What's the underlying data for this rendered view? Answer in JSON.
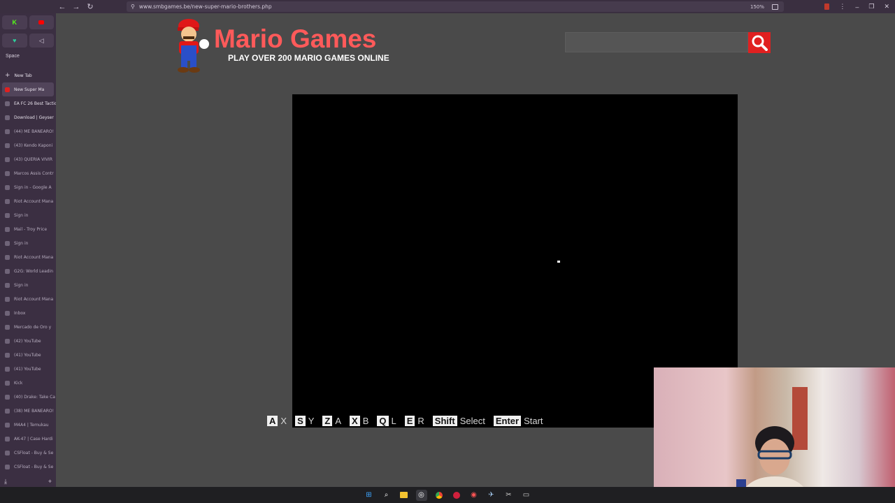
{
  "browser": {
    "url": "www.smbgames.be/new-super-mario-brothers.php",
    "zoom": "150%"
  },
  "sidebar": {
    "space_label": "Space",
    "new_tab_label": "New Tab",
    "tabs": [
      {
        "label": "New Super Ma",
        "active": true
      },
      {
        "label": "EA FC 26 Best Tactic"
      },
      {
        "label": "Download | Geyser"
      },
      {
        "label": "(44) ME BANEARO!"
      },
      {
        "label": "(43) Kendo Kaponi"
      },
      {
        "label": "(43) QUERIA VIVIR"
      },
      {
        "label": "Marcos Assis Contr"
      },
      {
        "label": "Sign in - Google A"
      },
      {
        "label": "Riot Account Mana"
      },
      {
        "label": "Sign in"
      },
      {
        "label": "Mail - Troy Price"
      },
      {
        "label": "Sign in"
      },
      {
        "label": "Riot Account Mana"
      },
      {
        "label": "G2G: World Leadin"
      },
      {
        "label": "Sign in"
      },
      {
        "label": "Riot Account Mana"
      },
      {
        "label": "Inbox"
      },
      {
        "label": "Mercado de Oro y"
      },
      {
        "label": "(42) YouTube"
      },
      {
        "label": "(41) YouTube"
      },
      {
        "label": "(41) YouTube"
      },
      {
        "label": "Kick"
      },
      {
        "label": "(40) Drake: Take Ca"
      },
      {
        "label": "(38) ME BANEARO!"
      },
      {
        "label": "M4A4 | Temukau"
      },
      {
        "label": "AK-47 | Case Hardi"
      },
      {
        "label": "CSFloat - Buy & Se"
      },
      {
        "label": "CSFloat - Buy & Se"
      }
    ]
  },
  "site": {
    "title": "Mario Games",
    "tagline": "PLAY OVER 200 MARIO GAMES ONLINE",
    "search_placeholder": ""
  },
  "controls": [
    {
      "key": "A",
      "action": "X"
    },
    {
      "key": "S",
      "action": "Y"
    },
    {
      "key": "Z",
      "action": "A"
    },
    {
      "key": "X",
      "action": "B"
    },
    {
      "key": "Q",
      "action": "L"
    },
    {
      "key": "E",
      "action": "R"
    },
    {
      "key": "Shift",
      "action": "Select"
    },
    {
      "key": "Enter",
      "action": "Start"
    }
  ],
  "colors": {
    "title": "#ff5a5a",
    "search_button": "#e02020",
    "page_bg": "#4a4a4a"
  }
}
